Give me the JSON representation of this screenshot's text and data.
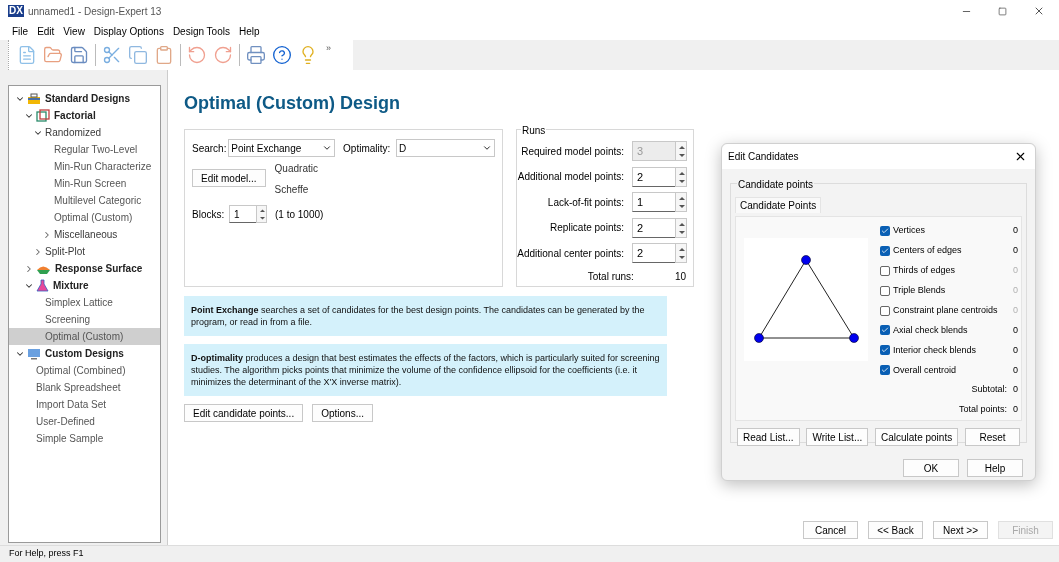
{
  "window": {
    "logo": "DX",
    "title": "unnamed1 - Design-Expert 13"
  },
  "menu": [
    "File",
    "Edit",
    "View",
    "Display Options",
    "Design Tools",
    "Help"
  ],
  "toolbar_overflow": "»",
  "tree": [
    {
      "label": "Standard Designs",
      "kind": "category",
      "expanded": true,
      "selected": false,
      "children": [
        {
          "label": "Factorial",
          "kind": "category",
          "expanded": true,
          "selected": false,
          "children": [
            {
              "label": "Randomized",
              "kind": "folder",
              "expanded": true,
              "selected": false,
              "children": [
                {
                  "label": "Regular Two-Level",
                  "kind": "item",
                  "selected": false
                },
                {
                  "label": "Min-Run Characterize",
                  "kind": "item",
                  "selected": false
                },
                {
                  "label": "Min-Run Screen",
                  "kind": "item",
                  "selected": false
                },
                {
                  "label": "Multilevel Categoric",
                  "kind": "item",
                  "selected": false
                },
                {
                  "label": "Optimal (Custom)",
                  "kind": "item",
                  "selected": false
                },
                {
                  "label": "Miscellaneous",
                  "kind": "folder",
                  "expanded": false,
                  "selected": false
                }
              ]
            },
            {
              "label": "Split-Plot",
              "kind": "folder",
              "expanded": false,
              "selected": false
            }
          ]
        },
        {
          "label": "Response Surface",
          "kind": "category",
          "expanded": false,
          "selected": false
        },
        {
          "label": "Mixture",
          "kind": "category",
          "expanded": true,
          "selected": false,
          "children": [
            {
              "label": "Simplex Lattice",
              "kind": "item",
              "selected": false
            },
            {
              "label": "Screening",
              "kind": "item",
              "selected": false
            },
            {
              "label": "Optimal (Custom)",
              "kind": "item",
              "selected": true
            }
          ]
        }
      ]
    },
    {
      "label": "Custom Designs",
      "kind": "category",
      "expanded": true,
      "selected": false,
      "children": [
        {
          "label": "Optimal (Combined)",
          "kind": "item",
          "selected": false
        },
        {
          "label": "Blank Spreadsheet",
          "kind": "item",
          "selected": false
        },
        {
          "label": "Import Data Set",
          "kind": "item",
          "selected": false
        },
        {
          "label": "User-Defined",
          "kind": "item",
          "selected": false
        },
        {
          "label": "Simple Sample",
          "kind": "item",
          "selected": false
        }
      ]
    }
  ],
  "page": {
    "title": "Optimal (Custom) Design",
    "search": {
      "label": "Search:",
      "value": "Point Exchange"
    },
    "optimality": {
      "label": "Optimality:",
      "value": "D"
    },
    "edit_model_button": "Edit model...",
    "model": [
      "Quadratic",
      "Scheffe"
    ],
    "blocks": {
      "label": "Blocks:",
      "value": "1",
      "range": "(1 to 1000)"
    }
  },
  "runs": {
    "title": "Runs",
    "fields": [
      {
        "label": "Required model points:",
        "value": "3",
        "disabled": true
      },
      {
        "label": "Additional model points:",
        "value": "2",
        "disabled": false
      },
      {
        "label": "Lack-of-fit points:",
        "value": "1",
        "disabled": false
      },
      {
        "label": "Replicate points:",
        "value": "2",
        "disabled": false
      },
      {
        "label": "Additional center points:",
        "value": "2",
        "disabled": false
      }
    ],
    "total": {
      "label": "Total runs:",
      "value": "10"
    }
  },
  "info": [
    "**Point Exchange** searches a set of candidates for the best design points. The candidates can be generated by the program, or read in from a file.",
    "**D-optimality** produces a design that best estimates the effects of the factors, which is particularly suited for screening studies. The algorithm picks points that minimize the volume of the confidence ellipsoid for the coefficients (i.e. it minimizes the determinant of the X'X inverse matrix)."
  ],
  "buttons": [
    "Edit candidate points...",
    "Options..."
  ],
  "wizard": [
    {
      "label": "Cancel",
      "disabled": false
    },
    {
      "label": "<< Back",
      "disabled": false
    },
    {
      "label": "Next >>",
      "disabled": false
    },
    {
      "label": "Finish",
      "disabled": true
    }
  ],
  "dialog": {
    "title": "Edit Candidates",
    "group": "Candidate points",
    "tab": "Candidate Points",
    "options": [
      {
        "label": "Vertices",
        "checked": true,
        "count": "0"
      },
      {
        "label": "Centers of edges",
        "checked": true,
        "count": "0"
      },
      {
        "label": "Thirds of edges",
        "checked": false,
        "count": "0"
      },
      {
        "label": "Triple Blends",
        "checked": false,
        "count": "0"
      },
      {
        "label": "Constraint plane centroids",
        "checked": false,
        "count": "0"
      },
      {
        "label": "Axial check blends",
        "checked": true,
        "count": "0"
      },
      {
        "label": "Interior check blends",
        "checked": true,
        "count": "0"
      },
      {
        "label": "Overall centroid",
        "checked": true,
        "count": "0"
      }
    ],
    "subtotal": {
      "label": "Subtotal:",
      "value": "0"
    },
    "total": {
      "label": "Total points:",
      "value": "0"
    },
    "list_buttons": [
      "Read List...",
      "Write List...",
      "Calculate points",
      "Reset"
    ],
    "buttons": [
      "OK",
      "Help"
    ]
  },
  "status_bar": "For Help, press F1"
}
